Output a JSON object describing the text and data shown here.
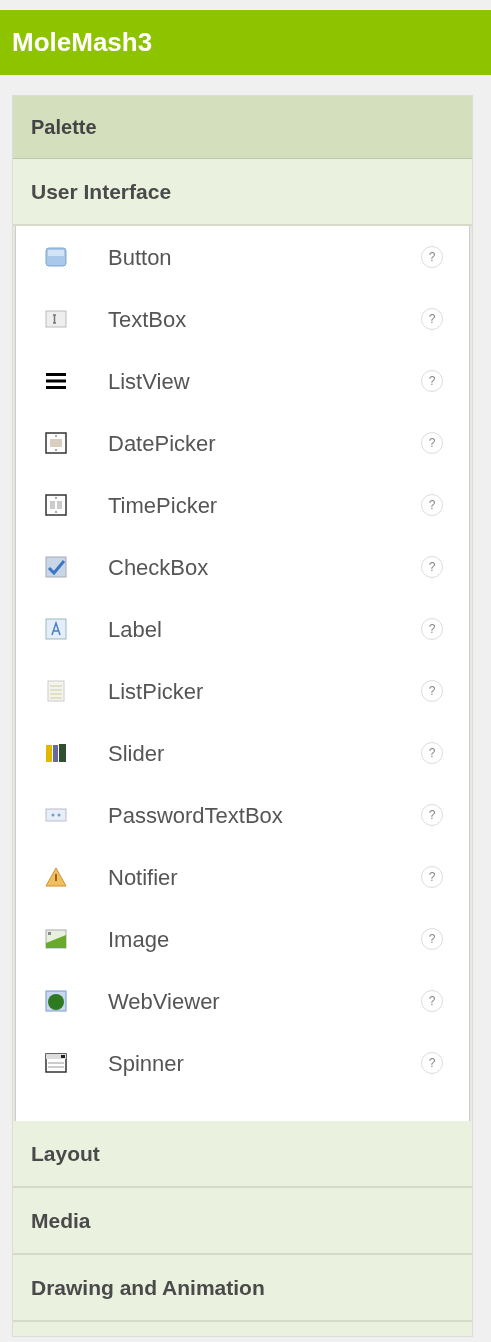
{
  "title": "MoleMash3",
  "palette": {
    "heading": "Palette",
    "categories": [
      {
        "label": "User Interface",
        "items": [
          {
            "kind": "button",
            "label": "Button",
            "help": "?"
          },
          {
            "kind": "textbox",
            "label": "TextBox",
            "help": "?"
          },
          {
            "kind": "listview",
            "label": "ListView",
            "help": "?"
          },
          {
            "kind": "datepicker",
            "label": "DatePicker",
            "help": "?"
          },
          {
            "kind": "timepicker",
            "label": "TimePicker",
            "help": "?"
          },
          {
            "kind": "checkbox",
            "label": "CheckBox",
            "help": "?"
          },
          {
            "kind": "label",
            "label": "Label",
            "help": "?"
          },
          {
            "kind": "listpicker",
            "label": "ListPicker",
            "help": "?"
          },
          {
            "kind": "slider",
            "label": "Slider",
            "help": "?"
          },
          {
            "kind": "password",
            "label": "PasswordTextBox",
            "help": "?"
          },
          {
            "kind": "notifier",
            "label": "Notifier",
            "help": "?"
          },
          {
            "kind": "image",
            "label": "Image",
            "help": "?"
          },
          {
            "kind": "webviewer",
            "label": "WebViewer",
            "help": "?"
          },
          {
            "kind": "spinner",
            "label": "Spinner",
            "help": "?"
          }
        ]
      },
      {
        "label": "Layout"
      },
      {
        "label": "Media"
      },
      {
        "label": "Drawing and Animation"
      }
    ]
  }
}
